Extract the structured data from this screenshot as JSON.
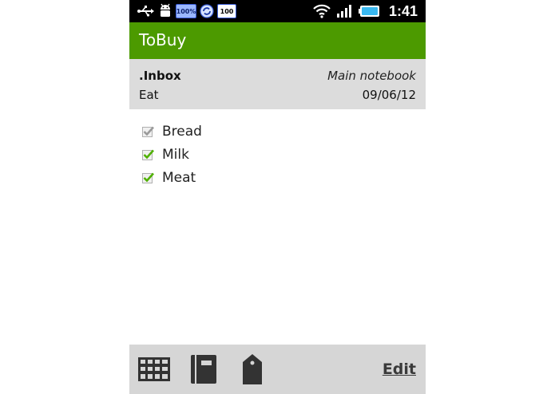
{
  "status_bar": {
    "sdcard_label": "100%",
    "battery_badge_label": "100",
    "time": "1:41"
  },
  "app": {
    "title": "ToBuy",
    "accent_color": "#4c9a00"
  },
  "note": {
    "folder": ".Inbox",
    "notebook": "Main notebook",
    "title": "Eat",
    "date": "09/06/12"
  },
  "checklist": {
    "items": [
      {
        "label": "Bread",
        "checked": true,
        "check_color": "#9a9a9a"
      },
      {
        "label": "Milk",
        "checked": true,
        "check_color": "#4fb000"
      },
      {
        "label": "Meat",
        "checked": true,
        "check_color": "#4fb000"
      }
    ]
  },
  "toolbar": {
    "icons": [
      "grid-icon",
      "notebook-icon",
      "tag-icon"
    ],
    "edit_label": "Edit"
  }
}
